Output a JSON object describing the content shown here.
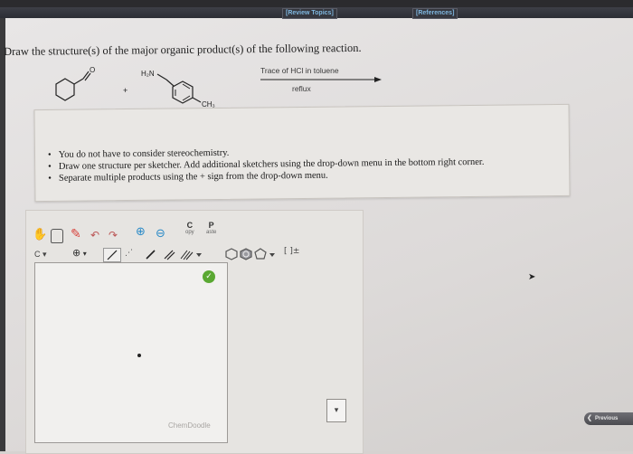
{
  "header": {
    "review_topics": "[Review Topics]",
    "references": "[References]"
  },
  "question": "Draw the structure(s) of the major organic product(s) of the following reaction.",
  "reaction": {
    "amine_label": "H₂N",
    "methyl_label": "CH₃",
    "carbonyl_o": "O",
    "plus": "+",
    "conditions_top": "Trace of HCl in toluene",
    "conditions_bottom": "reflux"
  },
  "instructions": [
    "You do not have to consider stereochemistry.",
    "Draw one structure per sketcher. Add additional sketchers using the drop-down menu in the bottom right corner.",
    "Separate multiple products using the + sign from the drop-down menu."
  ],
  "toolbar": {
    "copy_letter": "C",
    "copy_sub": "opy",
    "paste_letter": "P",
    "paste_sub": "aste",
    "carbon_selector": "C",
    "charge_symbol": "⊕",
    "bracket_label": "[ ]±"
  },
  "sketcher": {
    "brand": "ChemDoodle"
  },
  "bottom": {
    "dropdown_icon": "chevron-down-icon",
    "previous": "Previous"
  },
  "colors": {
    "nav_bar": "#2c2e35",
    "link": "#7fb7e0",
    "hand_tool": "#e07a24",
    "eraser_tool": "#d8423c",
    "zoom_tool": "#2a8ac7",
    "templates": "#6fa0c9",
    "ring_tools": "#9a9aa0"
  }
}
